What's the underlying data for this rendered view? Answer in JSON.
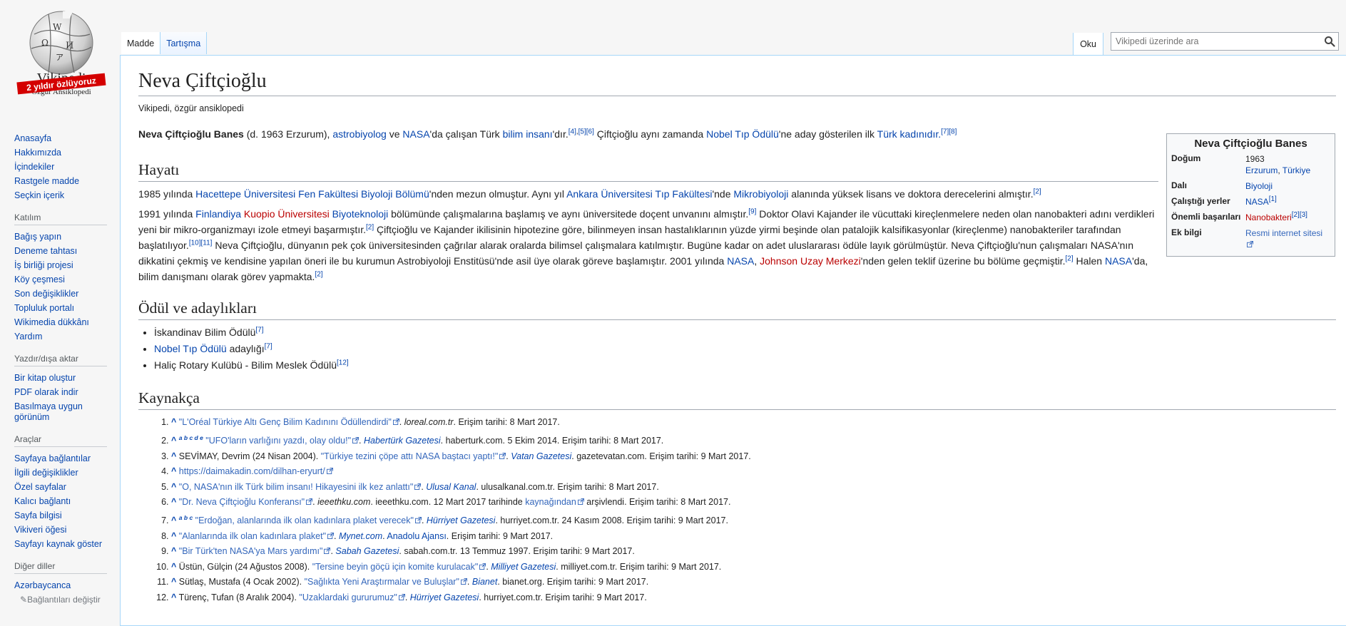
{
  "logo": {
    "wordmark": "Vikipedi",
    "tagline": "Özgür Ansiklopedi",
    "banner": "2 yıldır özlüyoruz"
  },
  "sidebar": {
    "navigation": [
      "Anasayfa",
      "Hakkımızda",
      "İçindekiler",
      "Rastgele madde",
      "Seçkin içerik"
    ],
    "participation": {
      "heading": "Katılım",
      "items": [
        "Bağış yapın",
        "Deneme tahtası",
        "İş birliği projesi",
        "Köy çeşmesi",
        "Son değişiklikler",
        "Topluluk portalı",
        "Wikimedia dükkânı",
        "Yardım"
      ]
    },
    "print": {
      "heading": "Yazdır/dışa aktar",
      "items": [
        "Bir kitap oluştur",
        "PDF olarak indir",
        "Basılmaya uygun görünüm"
      ]
    },
    "tools": {
      "heading": "Araçlar",
      "items": [
        "Sayfaya bağlantılar",
        "İlgili değişiklikler",
        "Özel sayfalar",
        "Kalıcı bağlantı",
        "Sayfa bilgisi",
        "Vikiveri öğesi",
        "Sayfayı kaynak göster"
      ]
    },
    "languages": {
      "heading": "Diğer diller",
      "items": [
        "Azərbaycanca"
      ],
      "edit_links": "Bağlantıları değiştir"
    }
  },
  "tabs": {
    "article": "Madde",
    "talk": "Tartışma",
    "read": "Oku"
  },
  "search": {
    "placeholder": "Vikipedi üzerinde ara",
    "value": ""
  },
  "article": {
    "title": "Neva Çiftçioğlu",
    "subtitle": "Vikipedi, özgür ansiklopedi",
    "intro": {
      "name": "Neva Çiftçioğlu Banes",
      "t1": " (d. 1963 Erzurum), ",
      "l1": "astrobiyolog",
      "t2": " ve ",
      "l2": "NASA",
      "t3": "'da çalışan Türk ",
      "l3": "bilim insanı",
      "t4": "'dır.",
      "s1": "[4]",
      "s2": ",",
      "s3": "[5]",
      "s4": "[6]",
      "t5": " Çiftçioğlu aynı zamanda ",
      "l4": "Nobel Tıp Ödülü",
      "t6": "'ne aday gösterilen ilk ",
      "l5": "Türk kadınıdır.",
      "s5": "[7]",
      "s6": "[8]"
    },
    "h_life": "Hayatı",
    "life1": {
      "t1": "1985 yılında ",
      "l1": "Hacettepe Üniversitesi Fen Fakültesi Biyoloji Bölümü",
      "t2": "'nden mezun olmuştur. Aynı yıl ",
      "l2": "Ankara Üniversitesi Tıp Fakültesi",
      "t3": "'nde ",
      "l3": "Mikrobiyoloji",
      "t4": " alanında yüksek lisans ve doktora derecelerini almıştır.",
      "s1": "[2]"
    },
    "life2": {
      "t1": "1991 yılında ",
      "l1": "Finlandiya",
      "t2": " ",
      "l2": "Kuopio Üniversitesi",
      "t3": " ",
      "l3": "Biyoteknoloji",
      "t4": " bölümünde çalışmalarına başlamış ve aynı üniversitede doçent unvanını almıştır.",
      "s1": "[9]",
      "t5": " Doktor Olavi Kajander ile vücuttaki kireçlenmelere neden olan nanobakteri adını verdikleri yeni bir mikro-organizmayı izole etmeyi başarmıştır.",
      "s2": "[2]",
      "t6": " Çiftçioğlu ve Kajander ikilisinin hipotezine göre, bilinmeyen insan hastalıklarının yüzde yirmi beşinde olan patalojik kalsifikasyonlar (kireçlenme) nanobakteriler tarafından başlatılıyor.",
      "s3": "[10]",
      "s4": "[11]",
      "t7": " Neva Çiftçioğlu, dünyanın pek çok üniversitesinden çağrılar alarak oralarda bilimsel çalışmalara katılmıştır. Bugüne kadar on adet uluslararası ödüle layık görülmüştür. Neva Çiftçioğlu'nun çalışmaları NASA'nın dikkatini çekmiş ve kendisine yapılan öneri ile bu kurumun Astrobiyoloji Enstitüsü'nde asil üye olarak göreve başlamıştır. 2001 yılında ",
      "l4": "NASA",
      "t8": ", ",
      "l5": "Johnson Uzay Merkezi",
      "t9": "'nden gelen teklif üzerine bu bölüme geçmiştir.",
      "s5": "[2]",
      "t10": " Halen ",
      "l6": "NASA",
      "t11": "'da, bilim danışmanı olarak görev yapmakta.",
      "s6": "[2]"
    },
    "h_awards": "Ödül ve adaylıkları",
    "awards": {
      "a1": "İskandinav Bilim Ödülü",
      "a1s": "[7]",
      "a2l": "Nobel Tıp Ödülü",
      "a2t": " adaylığı",
      "a2s": "[7]",
      "a3": "Haliç Rotary Kulübü - Bilim Meslek Ödülü",
      "a3s": "[12]"
    },
    "h_refs": "Kaynakça",
    "refs": {
      "caret": "^",
      "r1": {
        "link": "\"L'Oréal Türkiye Altı Genç Bilim Kadınını Ödüllendirdi\"",
        "t1": ". ",
        "it": "loreal.com.tr",
        "t2": ". Erişim tarihi: 8 Mart 2017."
      },
      "r2": {
        "letters": "a b c d e",
        "link": "\"UFO'ların varlığını yazdı, olay oldu!\"",
        "t1": ". ",
        "pub": "Habertürk Gazetesi",
        "t2": ". haberturk.com. 5 Ekim 2014. Erişim tarihi: 8 Mart 2017."
      },
      "r3": {
        "t0": "SEVİMAY, Devrim (24 Nisan 2004). ",
        "link": "\"Türkiye tezini çöpe attı NASA baştacı yaptı!\"",
        "t1": ". ",
        "pub": "Vatan Gazetesi",
        "t2": ". gazetevatan.com. Erişim tarihi: 9 Mart 2017."
      },
      "r4": {
        "link": "https://daimakadin.com/dilhan-eryurt/"
      },
      "r5": {
        "link": "\"O, NASA'nın ilk Türk bilim insanı! Hikayesini ilk kez anlattı\"",
        "t1": ". ",
        "pub": "Ulusal Kanal",
        "t2": ". ulusalkanal.com.tr. Erişim tarihi: 8 Mart 2017."
      },
      "r6": {
        "link": "\"Dr. Neva Çiftçioğlu Konferansı\"",
        "t1": ". ",
        "it": "ieeethku.com",
        "t2": ". ieeethku.com. 12 Mart 2017 tarihinde ",
        "l2": "kaynağından",
        "t3": " arşivlendi. Erişim tarihi: 8 Mart 2017."
      },
      "r7": {
        "letters": "a b c",
        "link": "\"Erdoğan, alanlarında ilk olan kadınlara plaket verecek\"",
        "t1": ". ",
        "pub": "Hürriyet Gazetesi",
        "t2": ". hurriyet.com.tr. 24 Kasım 2008. Erişim tarihi: 9 Mart 2017."
      },
      "r8": {
        "link": "\"Alanlarında ilk olan kadınlara plaket\"",
        "t1": ". ",
        "pub": "Mynet.com",
        "t2": ". ",
        "l2": "Anadolu Ajansı",
        "t3": ". Erişim tarihi: 9 Mart 2017."
      },
      "r9": {
        "link": "\"Bir Türk'ten NASA'ya Mars yardımı\"",
        "t1": ". ",
        "pub": "Sabah Gazetesi",
        "t2": ". sabah.com.tr. 13 Temmuz 1997. Erişim tarihi: 9 Mart 2017."
      },
      "r10": {
        "t0": "Üstün, Gülçin (24 Ağustos 2008). ",
        "link": "\"Tersine beyin göçü için komite kurulacak\"",
        "t1": ". ",
        "pub": "Milliyet Gazetesi",
        "t2": ". milliyet.com.tr. Erişim tarihi: 9 Mart 2017."
      },
      "r11": {
        "t0": "Sütlaş, Mustafa (4 Ocak 2002). ",
        "link": "\"Sağlıkta Yeni Araştırmalar ve Buluşlar\"",
        "t1": ". ",
        "pub": "Bianet",
        "t2": ". bianet.org. Erişim tarihi: 9 Mart 2017."
      },
      "r12": {
        "t0": "Türenç, Tufan (8 Aralık 2004). ",
        "link": "\"Uzaklardaki gururumuz\"",
        "t1": ". ",
        "pub": "Hürriyet Gazetesi",
        "t2": ". hurriyet.com.tr. Erişim tarihi: 9 Mart 2017."
      }
    }
  },
  "infobox": {
    "title": "Neva Çiftçioğlu Banes",
    "birth_label": "Doğum",
    "birth_year": "1963",
    "birth_city": "Erzurum",
    "birth_sep": ", ",
    "birth_country": "Türkiye",
    "field_label": "Dalı",
    "field_value": "Biyoloji",
    "work_label": "Çalıştığı yerler",
    "work_value": "NASA",
    "work_sup": "[1]",
    "achieve_label": "Önemli başarıları",
    "achieve_value": "Nanobakteri",
    "achieve_sup1": "[2]",
    "achieve_sup2": "[3]",
    "extra_label": "Ek bilgi",
    "extra_value": "Resmi internet sitesi"
  }
}
